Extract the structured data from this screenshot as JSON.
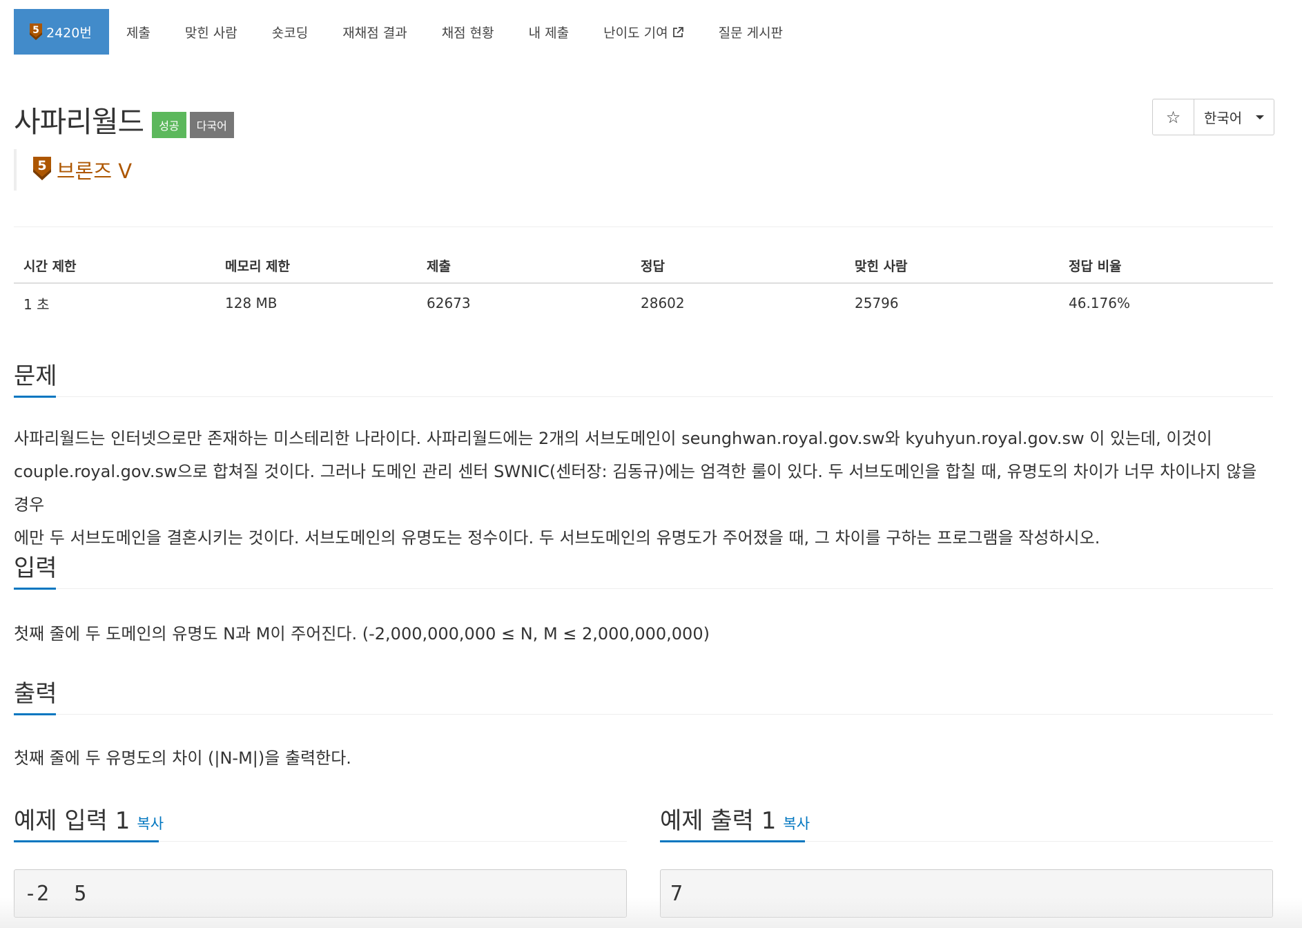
{
  "tabs": [
    {
      "label": "2420번"
    },
    {
      "label": "제출"
    },
    {
      "label": "맞힌 사람"
    },
    {
      "label": "숏코딩"
    },
    {
      "label": "재채점 결과"
    },
    {
      "label": "채점 현황"
    },
    {
      "label": "내 제출"
    },
    {
      "label": "난이도 기여"
    },
    {
      "label": "질문 게시판"
    }
  ],
  "tier_badge_number": "5",
  "problem": {
    "title": "사파리월드",
    "label_success": "성공",
    "label_multilang": "다국어",
    "tier": "브론즈 V"
  },
  "star_icon": "☆",
  "language": "한국어",
  "info": {
    "headers": [
      "시간 제한",
      "메모리 제한",
      "제출",
      "정답",
      "맞힌 사람",
      "정답 비율"
    ],
    "values": [
      "1 초",
      "128 MB",
      "62673",
      "28602",
      "25796",
      "46.176%"
    ]
  },
  "sections": {
    "description_title": "문제",
    "description_lines": [
      "사파리월드는 인터넷으로만 존재하는 미스테리한 나라이다. 사파리월드에는 2개의 서브도메인이 seunghwan.royal.gov.sw와 kyuhyun.royal.gov.sw 이 있는데, 이것이",
      "couple.royal.gov.sw으로 합쳐질 것이다. 그러나 도메인 관리 센터 SWNIC(센터장: 김동규)에는 엄격한 룰이 있다. 두 서브도메인을 합칠 때, 유명도의 차이가 너무 차이나지 않을 경우",
      "에만 두 서브도메인을 결혼시키는 것이다. 서브도메인의 유명도는 정수이다. 두 서브도메인의 유명도가 주어졌을 때, 그 차이를 구하는 프로그램을 작성하시오."
    ],
    "input_title": "입력",
    "input_text": "첫째 줄에 두 도메인의 유명도 N과 M이 주어진다. (-2,000,000,000 ≤ N, M ≤ 2,000,000,000)",
    "output_title": "출력",
    "output_text": "첫째 줄에 두 유명도의 차이 (|N-M|)을 출력한다."
  },
  "samples": {
    "input_title": "예제 입력 1",
    "output_title": "예제 출력 1",
    "copy_label": "복사",
    "input_value": "-2  5",
    "output_value": "7"
  },
  "colors": {
    "primary": "#428bca",
    "accent_underline": "#0076c0",
    "success": "#5cb85c",
    "multilang": "#777777",
    "bronze": "#ad5600"
  }
}
